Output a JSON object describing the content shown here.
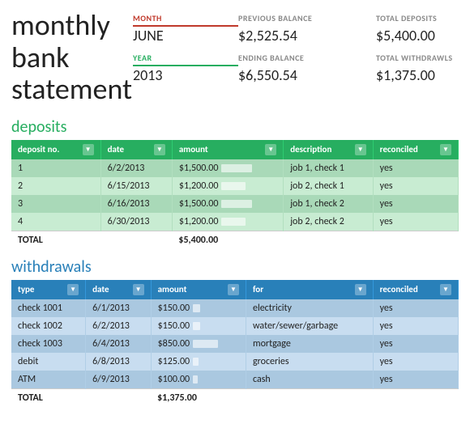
{
  "title": {
    "line1": "monthly",
    "line2": "bank",
    "line3": "statement"
  },
  "stats": {
    "month_label": "MONTH",
    "month_value": "JUNE",
    "prev_balance_label": "PREVIOUS BALANCE",
    "prev_balance_value": "$2,525.54",
    "total_deposits_label": "TOTAL DEPOSITS",
    "total_deposits_value": "$5,400.00",
    "year_label": "YEAR",
    "year_value": "2013",
    "ending_balance_label": "ENDING BALANCE",
    "ending_balance_value": "$6,550.54",
    "total_withdrawls_label": "TOTAL WITHDRAWLS",
    "total_withdrawls_value": "$1,375.00"
  },
  "deposits": {
    "section_title": "deposits",
    "columns": [
      "deposit no.",
      "date",
      "amount",
      "description",
      "reconciled"
    ],
    "rows": [
      {
        "no": "1",
        "date": "6/2/2013",
        "amount": "$1,500.00",
        "bar_pct": 75,
        "description": "job 1, check 1",
        "reconciled": "yes"
      },
      {
        "no": "2",
        "date": "6/15/2013",
        "amount": "$1,200.00",
        "bar_pct": 60,
        "description": "job 2, check 1",
        "reconciled": "yes"
      },
      {
        "no": "3",
        "date": "6/16/2013",
        "amount": "$1,500.00",
        "bar_pct": 75,
        "description": "job 1, check 2",
        "reconciled": "yes"
      },
      {
        "no": "4",
        "date": "6/30/2013",
        "amount": "$1,200.00",
        "bar_pct": 60,
        "description": "job 2, check 2",
        "reconciled": "yes"
      }
    ],
    "total_label": "TOTAL",
    "total_value": "$5,400.00"
  },
  "withdrawals": {
    "section_title": "withdrawals",
    "columns": [
      "type",
      "date",
      "amount",
      "for",
      "reconciled"
    ],
    "rows": [
      {
        "type": "check 1001",
        "date": "6/1/2013",
        "amount": "$150.00",
        "bar_pct": 18,
        "for": "electricity",
        "reconciled": "yes"
      },
      {
        "type": "check 1002",
        "date": "6/2/2013",
        "amount": "$150.00",
        "bar_pct": 18,
        "for": "water/sewer/garbage",
        "reconciled": "yes"
      },
      {
        "type": "check 1003",
        "date": "6/4/2013",
        "amount": "$850.00",
        "bar_pct": 62,
        "for": "mortgage",
        "reconciled": "yes"
      },
      {
        "type": "debit",
        "date": "6/8/2013",
        "amount": "$125.00",
        "bar_pct": 14,
        "for": "groceries",
        "reconciled": "yes"
      },
      {
        "type": "ATM",
        "date": "6/9/2013",
        "amount": "$100.00",
        "bar_pct": 12,
        "for": "cash",
        "reconciled": "yes"
      }
    ],
    "total_label": "TOTAL",
    "total_value": "$1,375.00"
  }
}
